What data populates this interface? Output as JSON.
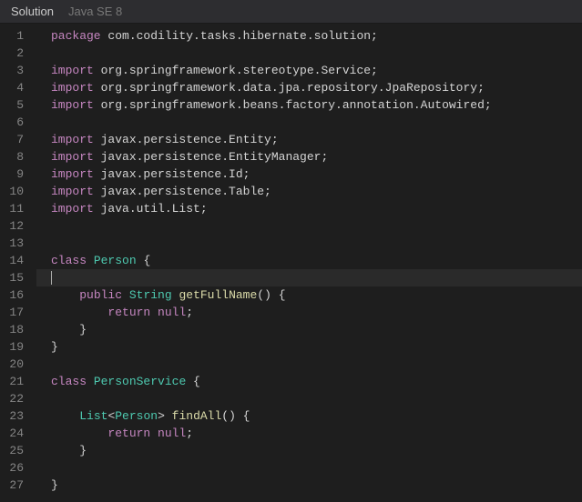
{
  "header": {
    "tabs": [
      {
        "label": "Solution",
        "active": true
      },
      {
        "label": "Java SE 8",
        "active": false
      }
    ]
  },
  "editor": {
    "activeLine": 15,
    "lines": [
      {
        "n": 1,
        "tokens": [
          [
            "kw",
            "package"
          ],
          [
            "punct",
            " com.codility.tasks.hibernate.solution;"
          ]
        ]
      },
      {
        "n": 2,
        "tokens": []
      },
      {
        "n": 3,
        "tokens": [
          [
            "kw",
            "import"
          ],
          [
            "punct",
            " org.springframework.stereotype.Service;"
          ]
        ]
      },
      {
        "n": 4,
        "tokens": [
          [
            "kw",
            "import"
          ],
          [
            "punct",
            " org.springframework.data.jpa.repository.JpaRepository;"
          ]
        ]
      },
      {
        "n": 5,
        "tokens": [
          [
            "kw",
            "import"
          ],
          [
            "punct",
            " org.springframework.beans.factory.annotation.Autowired;"
          ]
        ]
      },
      {
        "n": 6,
        "tokens": []
      },
      {
        "n": 7,
        "tokens": [
          [
            "kw",
            "import"
          ],
          [
            "punct",
            " javax.persistence.Entity;"
          ]
        ]
      },
      {
        "n": 8,
        "tokens": [
          [
            "kw",
            "import"
          ],
          [
            "punct",
            " javax.persistence.EntityManager;"
          ]
        ]
      },
      {
        "n": 9,
        "tokens": [
          [
            "kw",
            "import"
          ],
          [
            "punct",
            " javax.persistence.Id;"
          ]
        ]
      },
      {
        "n": 10,
        "tokens": [
          [
            "kw",
            "import"
          ],
          [
            "punct",
            " javax.persistence.Table;"
          ]
        ]
      },
      {
        "n": 11,
        "tokens": [
          [
            "kw",
            "import"
          ],
          [
            "punct",
            " java.util.List;"
          ]
        ]
      },
      {
        "n": 12,
        "tokens": []
      },
      {
        "n": 13,
        "tokens": []
      },
      {
        "n": 14,
        "tokens": [
          [
            "kw",
            "class"
          ],
          [
            "punct",
            " "
          ],
          [
            "type",
            "Person"
          ],
          [
            "punct",
            " {"
          ]
        ]
      },
      {
        "n": 15,
        "tokens": []
      },
      {
        "n": 16,
        "tokens": [
          [
            "punct",
            "    "
          ],
          [
            "kw",
            "public"
          ],
          [
            "punct",
            " "
          ],
          [
            "type",
            "String"
          ],
          [
            "punct",
            " "
          ],
          [
            "method",
            "getFullName"
          ],
          [
            "punct",
            "() {"
          ]
        ]
      },
      {
        "n": 17,
        "tokens": [
          [
            "punct",
            "        "
          ],
          [
            "kw",
            "return"
          ],
          [
            "punct",
            " "
          ],
          [
            "kw",
            "null"
          ],
          [
            "punct",
            ";"
          ]
        ]
      },
      {
        "n": 18,
        "tokens": [
          [
            "punct",
            "    }"
          ]
        ]
      },
      {
        "n": 19,
        "tokens": [
          [
            "punct",
            "}"
          ]
        ]
      },
      {
        "n": 20,
        "tokens": []
      },
      {
        "n": 21,
        "tokens": [
          [
            "kw",
            "class"
          ],
          [
            "punct",
            " "
          ],
          [
            "type",
            "PersonService"
          ],
          [
            "punct",
            " {"
          ]
        ]
      },
      {
        "n": 22,
        "tokens": []
      },
      {
        "n": 23,
        "tokens": [
          [
            "punct",
            "    "
          ],
          [
            "type",
            "List"
          ],
          [
            "punct",
            "<"
          ],
          [
            "type",
            "Person"
          ],
          [
            "punct",
            "> "
          ],
          [
            "method",
            "findAll"
          ],
          [
            "punct",
            "() {"
          ]
        ]
      },
      {
        "n": 24,
        "tokens": [
          [
            "punct",
            "        "
          ],
          [
            "kw",
            "return"
          ],
          [
            "punct",
            " "
          ],
          [
            "kw",
            "null"
          ],
          [
            "punct",
            ";"
          ]
        ]
      },
      {
        "n": 25,
        "tokens": [
          [
            "punct",
            "    }"
          ]
        ]
      },
      {
        "n": 26,
        "tokens": []
      },
      {
        "n": 27,
        "tokens": [
          [
            "punct",
            "}"
          ]
        ]
      }
    ]
  }
}
